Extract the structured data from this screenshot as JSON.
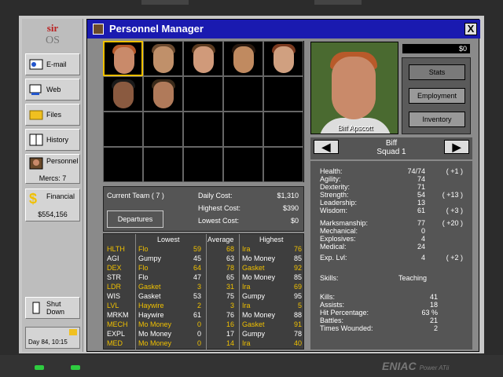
{
  "sidebar": {
    "logo_top": "sir",
    "logo_bottom": "OS",
    "email": "E-mail",
    "web": "Web",
    "files": "Files",
    "history": "History",
    "personnel": "Personnel",
    "mercs": "Mercs: 7",
    "financial": "Financial",
    "balance": "$554,156",
    "shutdown": "Shut Down",
    "day": "Day 84, 10:15"
  },
  "window": {
    "title": "Personnel Manager",
    "close": "X"
  },
  "team": {
    "current_team": "Current Team ( 7 )",
    "daily_cost_label": "Daily Cost:",
    "daily_cost": "$1,310",
    "highest_cost_label": "Highest Cost:",
    "highest_cost": "$390",
    "lowest_cost_label": "Lowest Cost:",
    "lowest_cost": "$0",
    "departures": "Departures"
  },
  "stats_table": {
    "headers": {
      "lowest": "Lowest",
      "average": "Average",
      "highest": "Highest"
    },
    "rows": [
      {
        "stat": "HLTH",
        "low_name": "Flo",
        "low": "59",
        "avg": "68",
        "high_name": "Ira",
        "high": "76",
        "color": "#f0c000"
      },
      {
        "stat": "AGI",
        "low_name": "Gumpy",
        "low": "45",
        "avg": "63",
        "high_name": "Mo Money",
        "high": "85",
        "color": "#ffffff"
      },
      {
        "stat": "DEX",
        "low_name": "Flo",
        "low": "64",
        "avg": "78",
        "high_name": "Gasket",
        "high": "92",
        "color": "#f0c000"
      },
      {
        "stat": "STR",
        "low_name": "Flo",
        "low": "47",
        "avg": "65",
        "high_name": "Mo Money",
        "high": "85",
        "color": "#ffffff"
      },
      {
        "stat": "LDR",
        "low_name": "Gasket",
        "low": "3",
        "avg": "31",
        "high_name": "Ira",
        "high": "69",
        "color": "#f0c000"
      },
      {
        "stat": "WIS",
        "low_name": "Gasket",
        "low": "53",
        "avg": "75",
        "high_name": "Gumpy",
        "high": "95",
        "color": "#ffffff"
      },
      {
        "stat": "LVL",
        "low_name": "Haywire",
        "low": "2",
        "avg": "3",
        "high_name": "Ira",
        "high": "5",
        "color": "#f0c000"
      },
      {
        "stat": "MRKM",
        "low_name": "Haywire",
        "low": "61",
        "avg": "76",
        "high_name": "Mo Money",
        "high": "88",
        "color": "#ffffff"
      },
      {
        "stat": "MECH",
        "low_name": "Mo Money",
        "low": "0",
        "avg": "16",
        "high_name": "Gasket",
        "high": "91",
        "color": "#f0c000"
      },
      {
        "stat": "EXPL",
        "low_name": "Mo Money",
        "low": "0",
        "avg": "17",
        "high_name": "Gumpy",
        "high": "78",
        "color": "#ffffff"
      },
      {
        "stat": "MED",
        "low_name": "Mo Money",
        "low": "0",
        "avg": "14",
        "high_name": "Ira",
        "high": "40",
        "color": "#f0c000"
      }
    ]
  },
  "profile": {
    "portrait_name": "Biff Apscott",
    "money": "$0",
    "btn_stats": "Stats",
    "btn_employment": "Employment",
    "btn_inventory": "Inventory",
    "prev": "◀",
    "next": "▶",
    "name": "Biff",
    "squad": "Squad 1",
    "stats": [
      {
        "label": "Health:",
        "value": "74/74",
        "bonus": "( +1 )"
      },
      {
        "label": "Agility:",
        "value": "74",
        "bonus": ""
      },
      {
        "label": "Dexterity:",
        "value": "71",
        "bonus": ""
      },
      {
        "label": "Strength:",
        "value": "54",
        "bonus": "( +13 )"
      },
      {
        "label": "Leadership:",
        "value": "13",
        "bonus": ""
      },
      {
        "label": "Wisdom:",
        "value": "61",
        "bonus": "( +3 )"
      }
    ],
    "skills2": [
      {
        "label": "Marksmanship:",
        "value": "77",
        "bonus": "( +20 )"
      },
      {
        "label": "Mechanical:",
        "value": "0",
        "bonus": ""
      },
      {
        "label": "Explosives:",
        "value": "4",
        "bonus": ""
      },
      {
        "label": "Medical:",
        "value": "24",
        "bonus": ""
      }
    ],
    "exp_label": "Exp. Lvl:",
    "exp_value": "4",
    "exp_bonus": "( +2 )",
    "skills_label": "Skills:",
    "skills_value": "Teaching",
    "record": [
      {
        "label": "Kills:",
        "value": "41"
      },
      {
        "label": "Assists:",
        "value": "18"
      },
      {
        "label": "Hit Percentage:",
        "value": "63 %"
      },
      {
        "label": "Battles:",
        "value": "21"
      },
      {
        "label": "Times Wounded:",
        "value": "2"
      }
    ]
  },
  "footer": {
    "brand": "ENIAC",
    "model": "Power ATii"
  }
}
